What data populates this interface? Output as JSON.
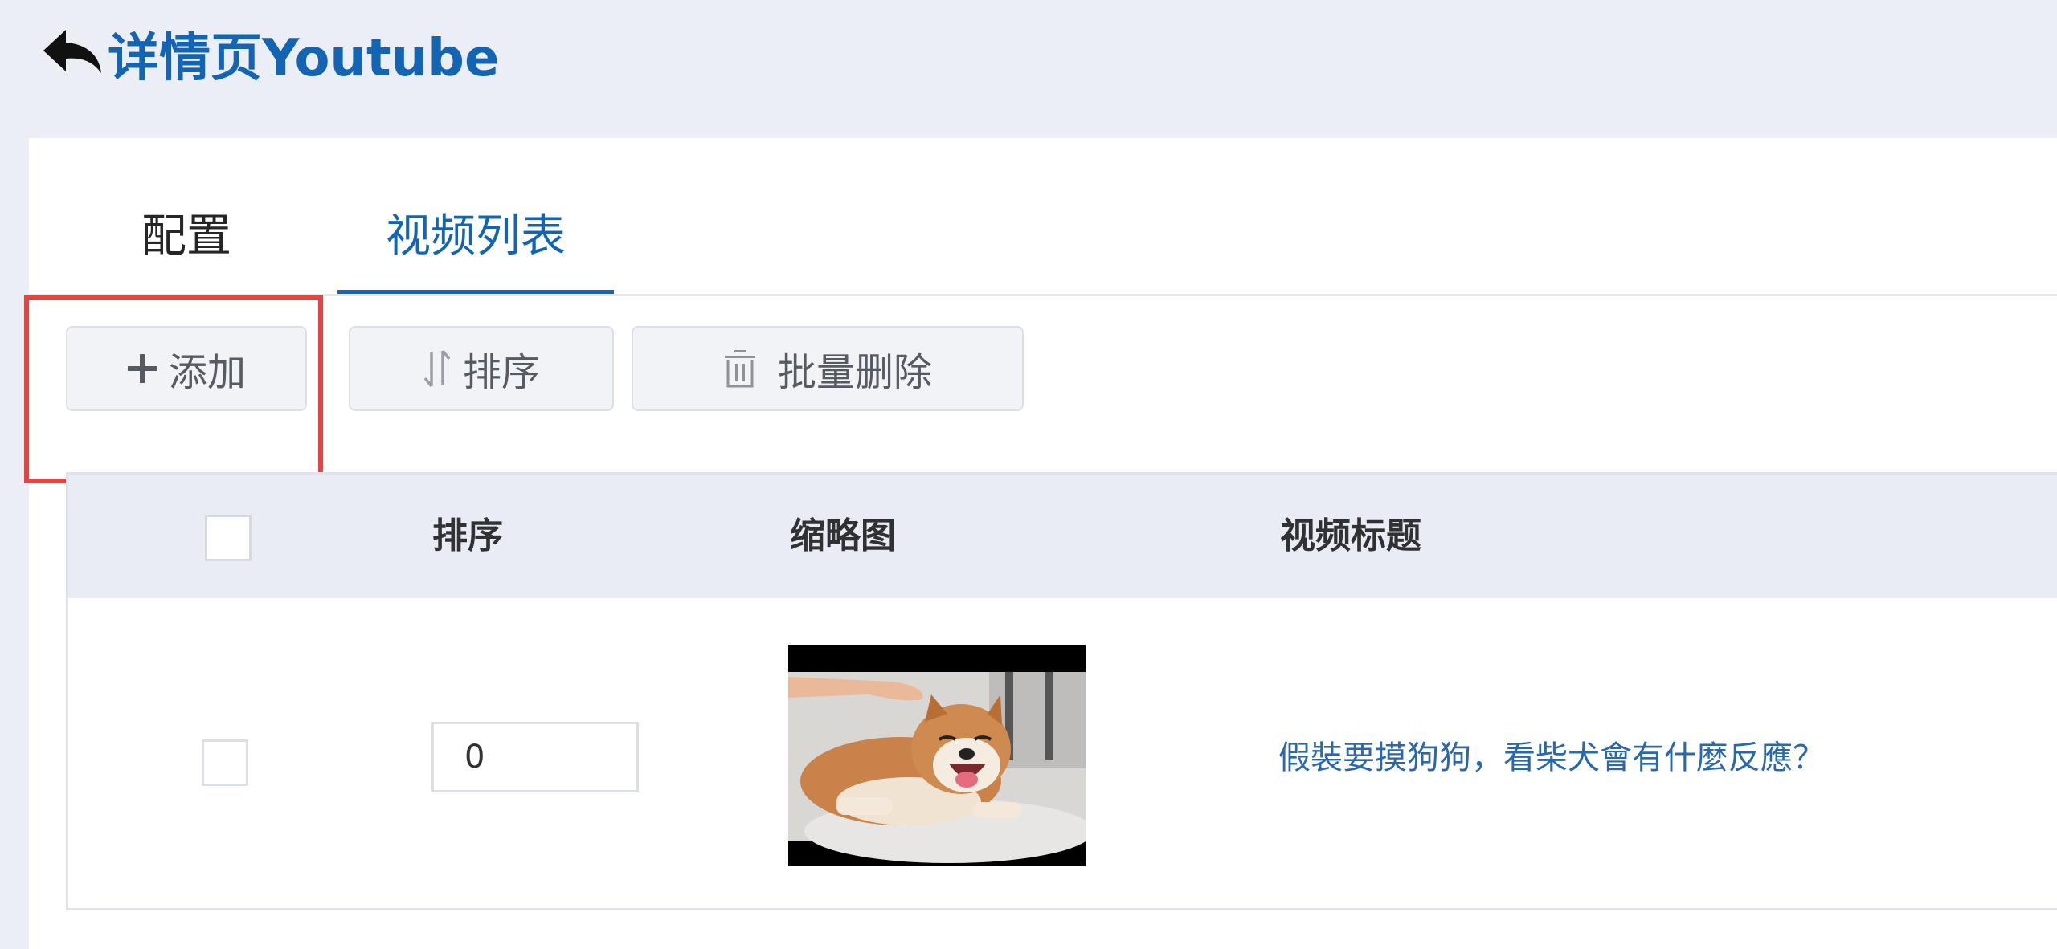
{
  "header": {
    "title": "详情页Youtube",
    "back_icon": "reply-arrow-icon",
    "title_color": "#1464b4"
  },
  "tabs": [
    {
      "label": "配置",
      "active": false
    },
    {
      "label": "视频列表",
      "active": true
    }
  ],
  "toolbar": {
    "add_label": "添加",
    "sort_label": "排序",
    "batch_delete_label": "批量删除",
    "add_icon": "plus-icon",
    "sort_icon": "sort-arrows-icon",
    "delete_icon": "trash-icon"
  },
  "table": {
    "columns": {
      "sort": "排序",
      "thumbnail": "缩略图",
      "title": "视频标题"
    },
    "rows": [
      {
        "checked": false,
        "sort": "0",
        "thumbnail": "shiba-inu-dog-thumbnail",
        "title": "假裝要摸狗狗，看柴犬會有什麼反應？"
      }
    ]
  },
  "colors": {
    "accent": "#1464b4",
    "link": "#2a68ad",
    "highlight": "#ec4141",
    "header_bg": "#e9ebf5",
    "page_bg": "#eceef5"
  }
}
